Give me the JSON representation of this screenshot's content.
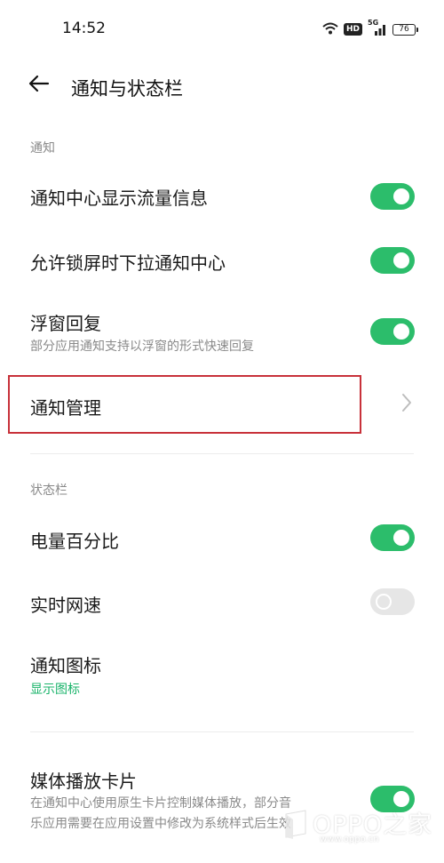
{
  "status_bar": {
    "time": "14:52",
    "hd_badge": "HD",
    "network_label": "5G",
    "battery_level": "76"
  },
  "header": {
    "back_icon": "arrow-left-icon",
    "title": "通知与状态栏"
  },
  "sections": {
    "notification": {
      "label": "通知",
      "items": [
        {
          "title": "通知中心显示流量信息",
          "toggle": true
        },
        {
          "title": "允许锁屏时下拉通知中心",
          "toggle": true
        },
        {
          "title": "浮窗回复",
          "subtitle": "部分应用通知支持以浮窗的形式快速回复",
          "toggle": true
        },
        {
          "title": "通知管理",
          "chevron": "chevron-right-icon"
        }
      ]
    },
    "status_bar_section": {
      "label": "状态栏",
      "items": [
        {
          "title": "电量百分比",
          "toggle": true
        },
        {
          "title": "实时网速",
          "toggle": false
        },
        {
          "title": "通知图标",
          "subtitle": "显示图标"
        },
        {
          "title": "媒体播放卡片",
          "subtitle_line1": "在通知中心使用原生卡片控制媒体播放，部分音",
          "subtitle_line2": "乐应用需要在应用设置中修改为系统样式后生效",
          "toggle": true
        }
      ]
    }
  },
  "colors": {
    "toggle_on": "#2cbd6b",
    "toggle_off": "#e6e6e6",
    "accent_text": "#19b36a",
    "highlight_border": "#c8313a"
  },
  "watermark": {
    "text": "OPPO之家",
    "url": "www.oppo.cn"
  }
}
